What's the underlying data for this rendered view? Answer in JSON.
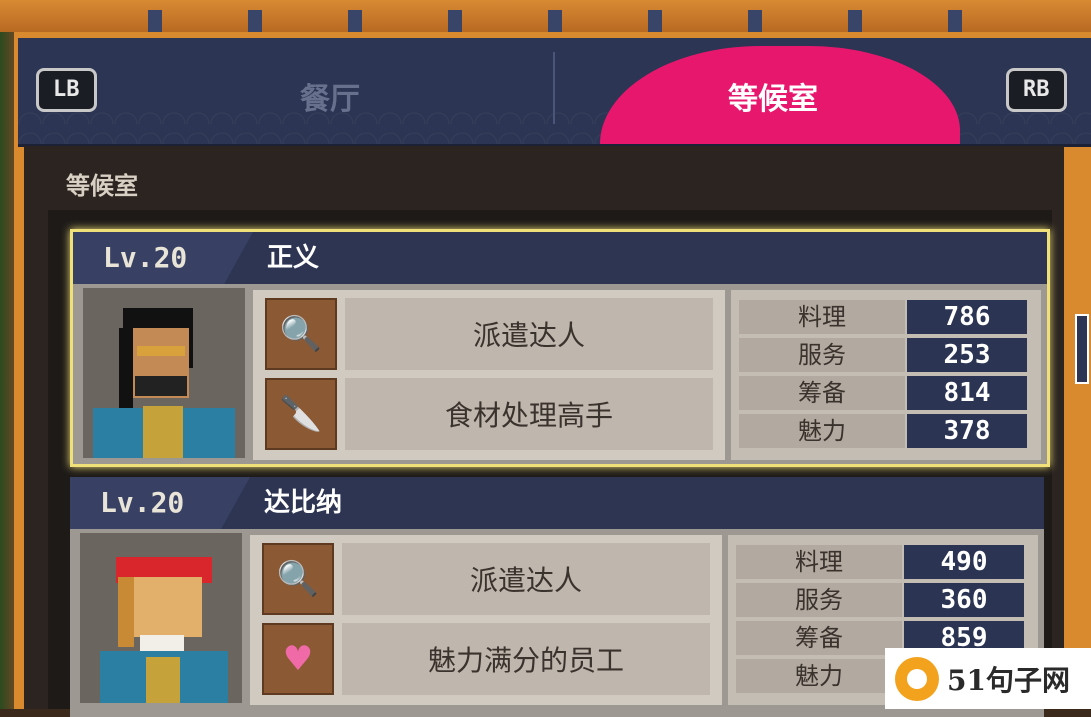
{
  "tabs": {
    "left_button": "LB",
    "right_button": "RB",
    "items": [
      {
        "label": "餐厅",
        "active": false
      },
      {
        "label": "等候室",
        "active": true
      }
    ]
  },
  "section_title": "等候室",
  "employees": [
    {
      "level": "Lv.20",
      "name": "正义",
      "selected": true,
      "skills": [
        {
          "icon": "magnifier-icon",
          "label": "派遣达人"
        },
        {
          "icon": "knife-icon",
          "label": "食材处理高手"
        }
      ],
      "stats": [
        {
          "label": "料理",
          "value": "786"
        },
        {
          "label": "服务",
          "value": "253"
        },
        {
          "label": "筹备",
          "value": "814"
        },
        {
          "label": "魅力",
          "value": "378"
        }
      ]
    },
    {
      "level": "Lv.20",
      "name": "达比纳",
      "selected": false,
      "skills": [
        {
          "icon": "magnifier-icon",
          "label": "派遣达人"
        },
        {
          "icon": "heart-icon",
          "label": "魅力满分的员工"
        }
      ],
      "stats": [
        {
          "label": "料理",
          "value": "490"
        },
        {
          "label": "服务",
          "value": "360"
        },
        {
          "label": "筹备",
          "value": "859"
        },
        {
          "label": "魅力",
          "value": ""
        }
      ]
    }
  ],
  "watermark": "51句子网",
  "colors": {
    "active_tab": "#e8176e",
    "header_bg": "#2c3553",
    "selected_border": "#f0e07a",
    "frame": "#d98a2f"
  }
}
